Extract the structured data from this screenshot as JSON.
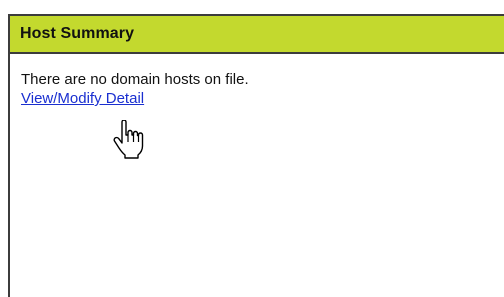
{
  "host_summary": {
    "title": "Host Summary",
    "message": "There are no domain hosts on file.",
    "link_label": "View/Modify Detail"
  },
  "cursor": {
    "icon": "hand-pointer-icon"
  }
}
